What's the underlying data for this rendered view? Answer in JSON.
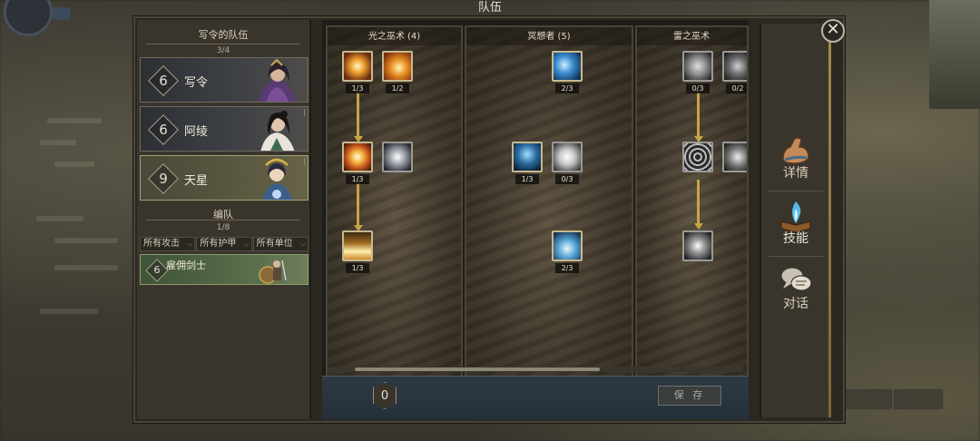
{
  "header": {
    "title": "队伍"
  },
  "team": {
    "title": "写令的队伍",
    "count": "3/4",
    "members": [
      {
        "level": "6",
        "name": "写令",
        "selected": false
      },
      {
        "level": "6",
        "name": "阿绫",
        "selected": false
      },
      {
        "level": "9",
        "name": "天星",
        "selected": true
      }
    ]
  },
  "formation": {
    "title": "编队",
    "count": "1/8",
    "filters": [
      "所有攻击",
      "所有护甲",
      "所有单位"
    ],
    "units": [
      {
        "level": "6",
        "name": "雇佣剑士"
      }
    ]
  },
  "skill_trees": [
    {
      "title": "光之巫术 (4)",
      "skills": [
        {
          "icon": "light-burst-icon",
          "count": "1/3"
        },
        {
          "icon": "radiant-orb-icon",
          "count": "1/2"
        },
        {
          "icon": "holy-strike-icon",
          "count": "1/3"
        },
        {
          "icon": "light-sphere-icon",
          "count": ""
        },
        {
          "icon": "light-pillar-icon",
          "count": "1/3"
        }
      ]
    },
    {
      "title": "冥想者 (5)",
      "skills": [
        {
          "icon": "meditation-swirl-icon",
          "count": "2/3"
        },
        {
          "icon": "spirit-form-icon",
          "count": "1/3"
        },
        {
          "icon": "white-wings-icon",
          "count": "0/3"
        },
        {
          "icon": "branching-lightning-icon",
          "count": "2/3"
        }
      ]
    },
    {
      "title": "雷之巫术",
      "skills": [
        {
          "icon": "wind-gust-icon",
          "count": "0/3"
        },
        {
          "icon": "storm-cloud-icon",
          "count": "0/2"
        },
        {
          "icon": "vortex-icon",
          "count": ""
        },
        {
          "icon": "thunder-bolt-icon",
          "count": ""
        },
        {
          "icon": "lightning-icon",
          "count": ""
        }
      ]
    }
  ],
  "footer": {
    "points": "0",
    "save_label": "保 存"
  },
  "nav": [
    {
      "icon": "flexed-arm-icon",
      "label": "详情",
      "active": false
    },
    {
      "icon": "spellbook-icon",
      "label": "技能",
      "active": true
    },
    {
      "icon": "speech-bubble-icon",
      "label": "对话",
      "active": false
    }
  ],
  "colors": {
    "gold": "#c5a548",
    "selected": "#676347",
    "merc": "#566b48"
  }
}
